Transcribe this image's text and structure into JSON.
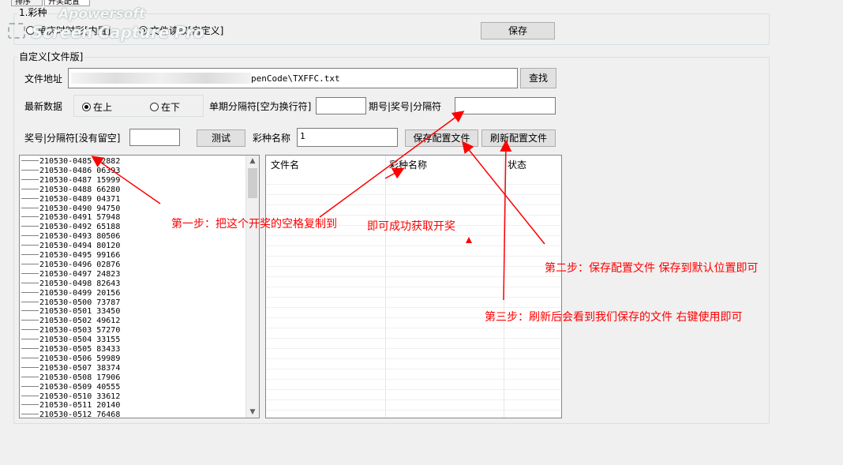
{
  "tabs": [
    {
      "label": "排序"
    },
    {
      "label": "开奖配置"
    }
  ],
  "group1": {
    "title": "1.彩种",
    "radio1": "重庆时时彩[内置]",
    "radio2": "文件读取[自定义]",
    "save_label": "保存"
  },
  "group2": {
    "title": "自定义[文件版]",
    "file_label": "文件地址",
    "file_value": "penCode\\TXFFC.txt",
    "find_label": "查找",
    "latest_label": "最新数据",
    "radio_top": "在上",
    "radio_bottom": "在下",
    "single_sep_label": "单期分隔符[空为换行符]",
    "single_sep_value": "",
    "period_sep_label": "期号|奖号|分隔符",
    "period_sep_value": "",
    "award_sep_label": "奖号|分隔符[没有留空]",
    "award_sep_value": "",
    "test_label": "测试",
    "lottery_name_label": "彩种名称",
    "lottery_name_value": "1",
    "save_config_label": "保存配置文件",
    "refresh_config_label": "刷新配置文件"
  },
  "draw_list": [
    "210530-0485  92882",
    "210530-0486  06393",
    "210530-0487  15999",
    "210530-0488  66280",
    "210530-0489  04371",
    "210530-0490  94750",
    "210530-0491  57948",
    "210530-0492  65188",
    "210530-0493  80506",
    "210530-0494  80120",
    "210530-0495  99166",
    "210530-0496  02876",
    "210530-0497  24823",
    "210530-0498  82643",
    "210530-0499  20156",
    "210530-0500  73787",
    "210530-0501  33450",
    "210530-0502  49612",
    "210530-0503  57270",
    "210530-0504  33155",
    "210530-0505  83433",
    "210530-0506  59989",
    "210530-0507  38374",
    "210530-0508  17906",
    "210530-0509  40555",
    "210530-0510  33612",
    "210530-0511  20140",
    "210530-0512  76468"
  ],
  "file_grid": {
    "columns": [
      "文件名",
      "彩种名称",
      "状态"
    ]
  },
  "annotations": {
    "step1": "第一步：把这个开奖的空格复制到",
    "step1b": "即可成功获取开奖",
    "step2": "第二步：保存配置文件 保存到默认位置即可",
    "step3": "第三步：刷新后会看到我们保存的文件 右键使用即可"
  },
  "watermark": {
    "line1": "Apowersoft",
    "line2": "Screen Capture Pro"
  },
  "colors": {
    "annotation": "#ff0000"
  }
}
